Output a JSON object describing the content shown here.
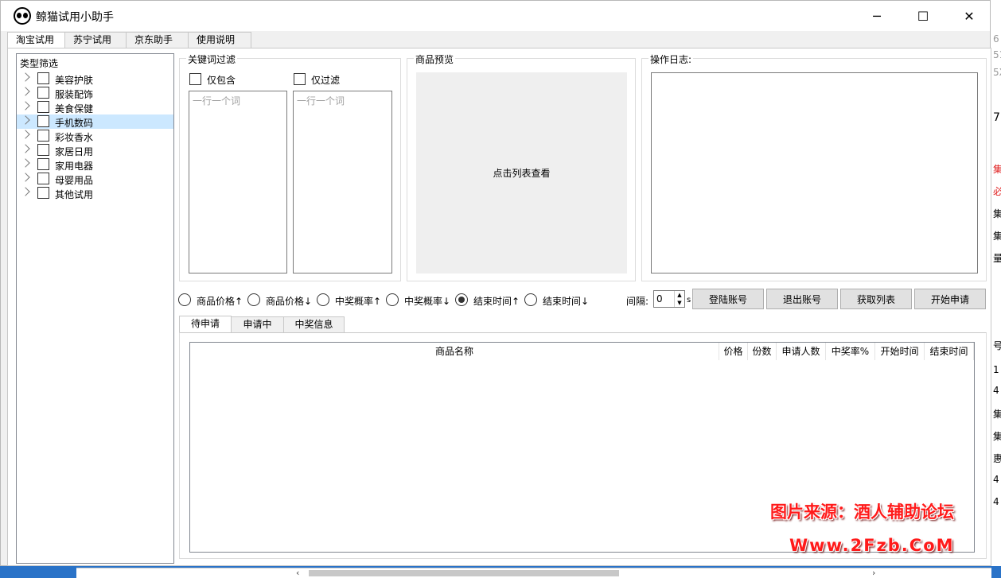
{
  "window": {
    "title": "鲸猫试用小助手",
    "icon": "panda-icon",
    "minimize": "─",
    "maximize": "☐",
    "close": "✕"
  },
  "main_tabs": [
    "淘宝试用",
    "苏宁试用",
    "京东助手",
    "使用说明"
  ],
  "category": {
    "title": "类型筛选",
    "items": [
      "美容护肤",
      "服装配饰",
      "美食保健",
      "手机数码",
      "彩妆香水",
      "家居日用",
      "家用电器",
      "母婴用品",
      "其他试用"
    ],
    "selected": "手机数码"
  },
  "keyword": {
    "title": "关键词过滤",
    "include_label": "仅包含",
    "exclude_label": "仅过滤",
    "include_placeholder": "一行一个词",
    "exclude_placeholder": "一行一个词"
  },
  "preview": {
    "title": "商品预览",
    "hint": "点击列表查看"
  },
  "log": {
    "title": "操作日志:"
  },
  "sort": {
    "options": [
      "商品价格↑",
      "商品价格↓",
      "中奖概率↑",
      "中奖概率↓",
      "结束时间↑",
      "结束时间↓"
    ],
    "selected": "结束时间↑"
  },
  "interval": {
    "label": "间隔:",
    "value": "0",
    "unit": "s"
  },
  "buttons": {
    "login": "登陆账号",
    "logout": "退出账号",
    "fetch": "获取列表",
    "start": "开始申请"
  },
  "list_tabs": [
    "待申请",
    "申请中",
    "中奖信息"
  ],
  "list_columns": [
    "商品名称",
    "价格",
    "份数",
    "申请人数",
    "中奖率%",
    "开始时间",
    "结束时间"
  ],
  "watermark": {
    "line1": "图片来源：酒人辅助论坛",
    "line2": "Www.2Fzb.CoM"
  },
  "background_window_glyphs": [
    "6",
    "51",
    "5X",
    "7",
    "集",
    "必",
    "集",
    "集",
    "量",
    "号",
    "1",
    "4",
    "集",
    "集",
    "惠",
    "4",
    "4"
  ]
}
